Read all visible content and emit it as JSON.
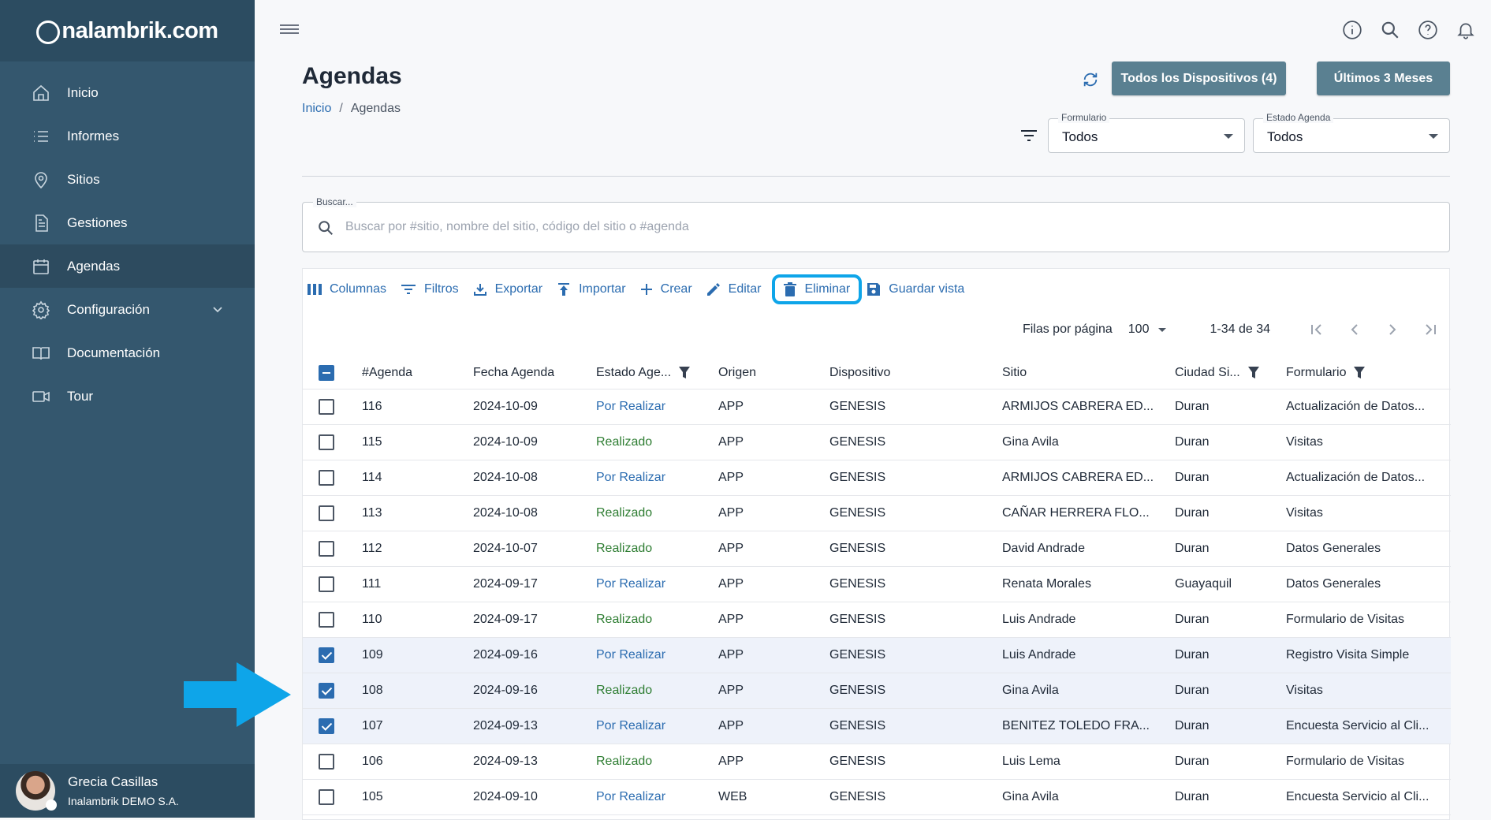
{
  "brand": {
    "logo_text": "nalambrik.com",
    "logo_letter": "i"
  },
  "sidebar": {
    "items": [
      {
        "label": "Inicio",
        "icon": "home-icon"
      },
      {
        "label": "Informes",
        "icon": "list-icon"
      },
      {
        "label": "Sitios",
        "icon": "location-pin-icon"
      },
      {
        "label": "Gestiones",
        "icon": "document-icon"
      },
      {
        "label": "Agendas",
        "icon": "calendar-icon",
        "active": true
      },
      {
        "label": "Configuración",
        "icon": "gear-icon",
        "expandable": true
      },
      {
        "label": "Documentación",
        "icon": "book-icon"
      },
      {
        "label": "Tour",
        "icon": "video-icon"
      }
    ],
    "user": {
      "name": "Grecia Casillas",
      "org": "Inalambrik DEMO S.A."
    }
  },
  "header": {
    "title": "Agendas",
    "breadcrumb": {
      "root": "Inicio",
      "separator": "/",
      "current": "Agendas"
    },
    "devices_button": "Todos los Dispositivos (4)",
    "period_button": "Últimos 3 Meses",
    "form_select": {
      "label": "Formulario",
      "value": "Todos"
    },
    "status_select": {
      "label": "Estado Agenda",
      "value": "Todos"
    }
  },
  "search": {
    "label": "Buscar...",
    "placeholder": "Buscar por #sitio, nombre del sitio, código del sitio o #agenda"
  },
  "toolbar": {
    "columns": "Columnas",
    "filters": "Filtros",
    "export": "Exportar",
    "import": "Importar",
    "create": "Crear",
    "edit": "Editar",
    "delete": "Eliminar",
    "save_view": "Guardar vista"
  },
  "pagination": {
    "rows_per_page_label": "Filas por página",
    "rows_per_page": "100",
    "range": "1-34 de 34"
  },
  "table": {
    "columns": [
      "#Agenda",
      "Fecha Agenda",
      "Estado Age...",
      "Origen",
      "Dispositivo",
      "Sitio",
      "Ciudad Si...",
      "Formulario"
    ],
    "rows": [
      {
        "id": "116",
        "date": "2024-10-09",
        "status": "Por Realizar",
        "origin": "APP",
        "device": "GENESIS",
        "site": "ARMIJOS CABRERA ED...",
        "city": "Duran",
        "form": "Actualización de Datos...",
        "checked": false
      },
      {
        "id": "115",
        "date": "2024-10-09",
        "status": "Realizado",
        "origin": "APP",
        "device": "GENESIS",
        "site": "Gina Avila",
        "city": "Duran",
        "form": "Visitas",
        "checked": false
      },
      {
        "id": "114",
        "date": "2024-10-08",
        "status": "Por Realizar",
        "origin": "APP",
        "device": "GENESIS",
        "site": "ARMIJOS CABRERA ED...",
        "city": "Duran",
        "form": "Actualización de Datos...",
        "checked": false
      },
      {
        "id": "113",
        "date": "2024-10-08",
        "status": "Realizado",
        "origin": "APP",
        "device": "GENESIS",
        "site": "CAÑAR HERRERA FLO...",
        "city": "Duran",
        "form": "Visitas",
        "checked": false
      },
      {
        "id": "112",
        "date": "2024-10-07",
        "status": "Realizado",
        "origin": "APP",
        "device": "GENESIS",
        "site": "David Andrade",
        "city": "Duran",
        "form": "Datos Generales",
        "checked": false
      },
      {
        "id": "111",
        "date": "2024-09-17",
        "status": "Por Realizar",
        "origin": "APP",
        "device": "GENESIS",
        "site": "Renata Morales",
        "city": "Guayaquil",
        "form": "Datos Generales",
        "checked": false
      },
      {
        "id": "110",
        "date": "2024-09-17",
        "status": "Realizado",
        "origin": "APP",
        "device": "GENESIS",
        "site": "Luis Andrade",
        "city": "Duran",
        "form": "Formulario de Visitas",
        "checked": false
      },
      {
        "id": "109",
        "date": "2024-09-16",
        "status": "Por Realizar",
        "origin": "APP",
        "device": "GENESIS",
        "site": "Luis Andrade",
        "city": "Duran",
        "form": "Registro Visita Simple",
        "checked": true
      },
      {
        "id": "108",
        "date": "2024-09-16",
        "status": "Realizado",
        "origin": "APP",
        "device": "GENESIS",
        "site": "Gina Avila",
        "city": "Duran",
        "form": "Visitas",
        "checked": true
      },
      {
        "id": "107",
        "date": "2024-09-13",
        "status": "Por Realizar",
        "origin": "APP",
        "device": "GENESIS",
        "site": "BENITEZ TOLEDO FRA...",
        "city": "Duran",
        "form": "Encuesta Servicio al Cli...",
        "checked": true
      },
      {
        "id": "106",
        "date": "2024-09-13",
        "status": "Realizado",
        "origin": "APP",
        "device": "GENESIS",
        "site": "Luis Lema",
        "city": "Duran",
        "form": "Formulario de Visitas",
        "checked": false
      },
      {
        "id": "105",
        "date": "2024-09-10",
        "status": "Por Realizar",
        "origin": "WEB",
        "device": "GENESIS",
        "site": "Gina Avila",
        "city": "Duran",
        "form": "Encuesta Servicio al Cli...",
        "checked": false
      }
    ]
  },
  "colors": {
    "sidebar": "#34576e",
    "accent": "#2b6cb0",
    "done": "#2e7d32",
    "highlight": "#0ea5e9",
    "button": "#5a8091"
  }
}
